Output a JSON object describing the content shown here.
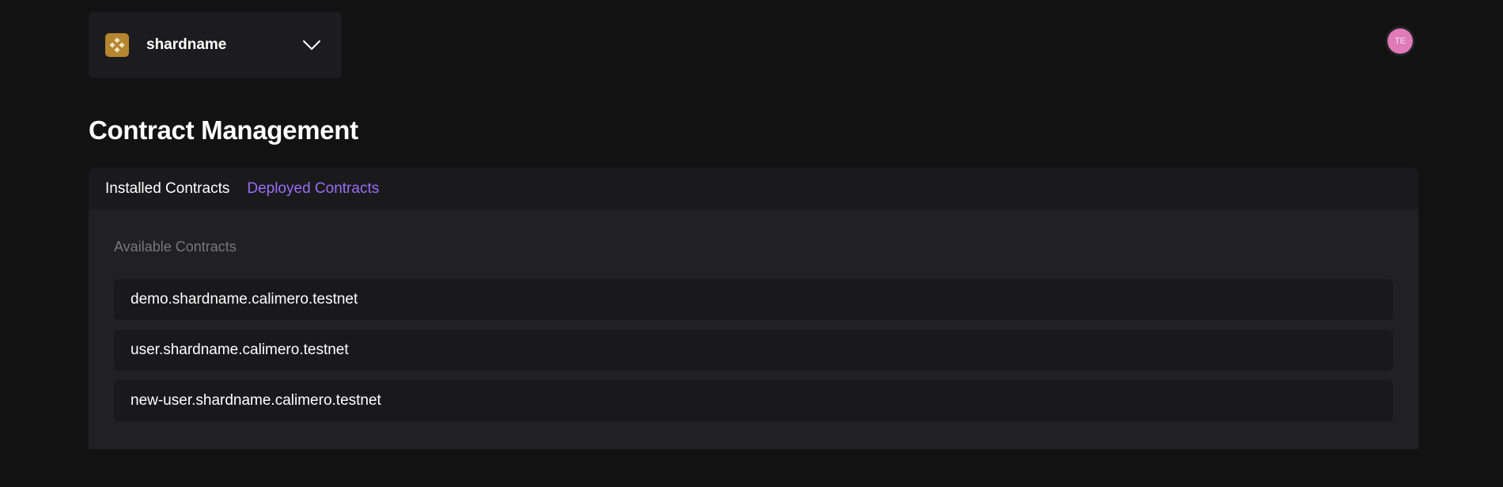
{
  "shard_selector": {
    "name": "shardname",
    "logo_icon": "diamond-cluster-icon",
    "dropdown_icon": "chevron-down-icon",
    "logo_color": "#b5852f"
  },
  "user_avatar": {
    "initials": "TE",
    "color": "#e07ab8"
  },
  "page_title": "Contract Management",
  "tabs": [
    {
      "label": "Installed Contracts",
      "active": true
    },
    {
      "label": "Deployed Contracts",
      "active": false
    }
  ],
  "available_contracts": {
    "label": "Available Contracts",
    "items": [
      "demo.shardname.calimero.testnet",
      "user.shardname.calimero.testnet",
      "new-user.shardname.calimero.testnet"
    ]
  },
  "colors": {
    "background": "#121212",
    "accent": "#9b6cf7"
  }
}
